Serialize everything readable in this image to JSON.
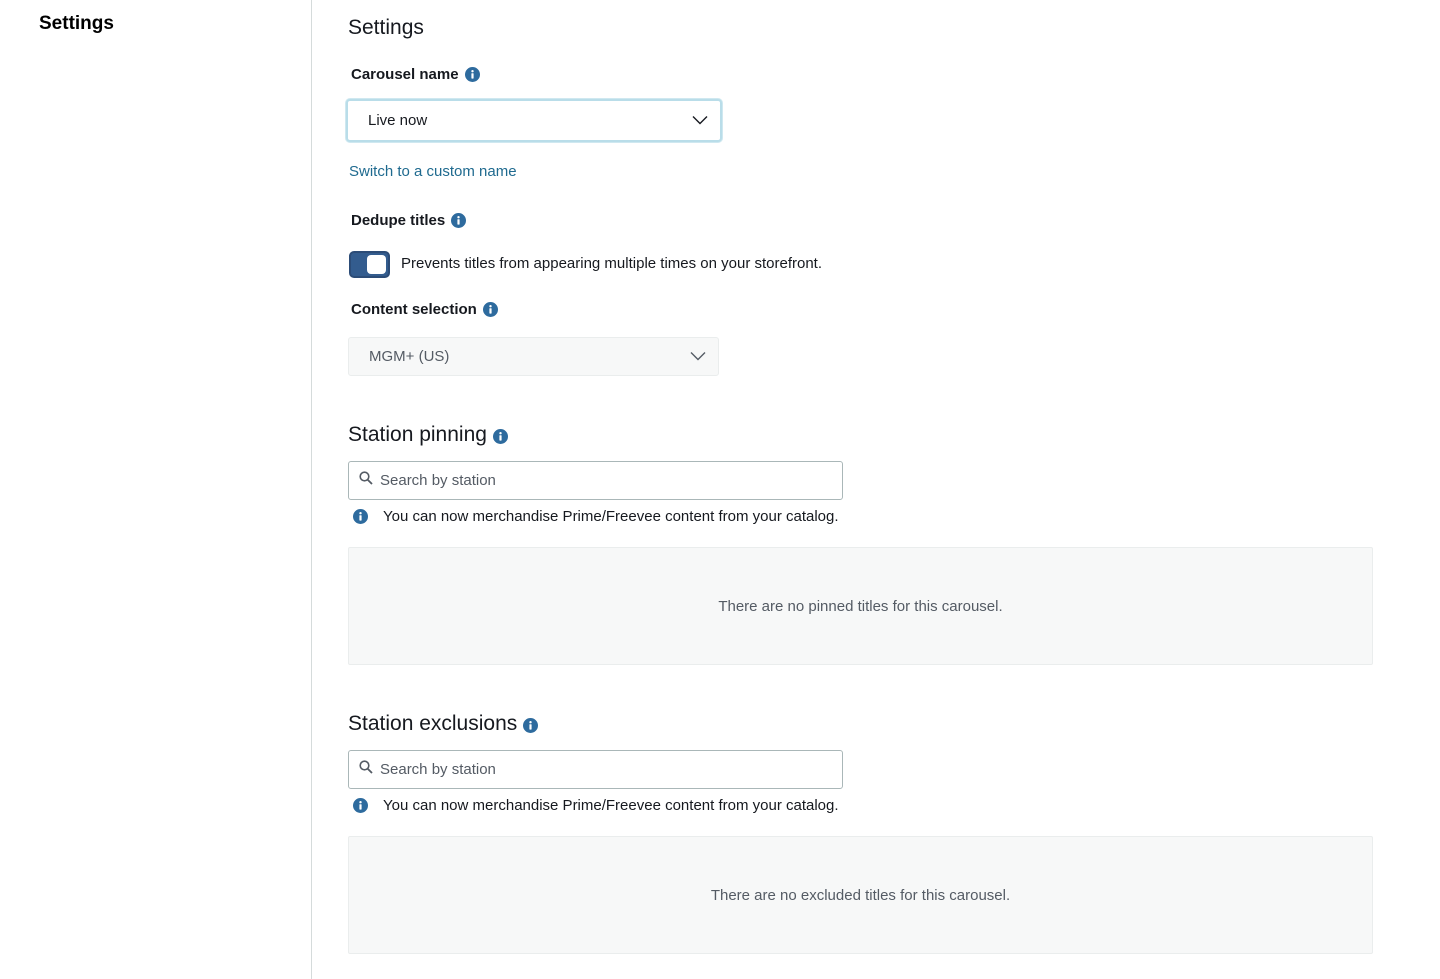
{
  "sidebar": {
    "title": "Settings"
  },
  "main": {
    "title": "Settings",
    "carousel_name": {
      "label": "Carousel name",
      "value": "Live now",
      "switch_link": "Switch to a custom name"
    },
    "dedupe": {
      "label": "Dedupe titles",
      "enabled": true,
      "description": "Prevents titles from appearing multiple times on your storefront."
    },
    "content_selection": {
      "label": "Content selection",
      "value": "MGM+ (US)"
    },
    "station_pinning": {
      "title": "Station pinning",
      "search_placeholder": "Search by station",
      "hint": "You can now merchandise Prime/Freevee content from your catalog.",
      "empty_text": "There are no pinned titles for this carousel."
    },
    "station_exclusions": {
      "title": "Station exclusions",
      "search_placeholder": "Search by station",
      "hint": "You can now merchandise Prime/Freevee content from your catalog.",
      "empty_text": "There are no excluded titles for this carousel."
    }
  },
  "colors": {
    "accent": "#2e6b9e",
    "link": "#1f6a8f",
    "toggle_on": "#335c8e",
    "border": "#aab7b8",
    "empty_bg": "#f7f8f8"
  },
  "icons": {
    "info": "info-icon",
    "chevron": "chevron-down-icon",
    "search": "search-icon"
  }
}
